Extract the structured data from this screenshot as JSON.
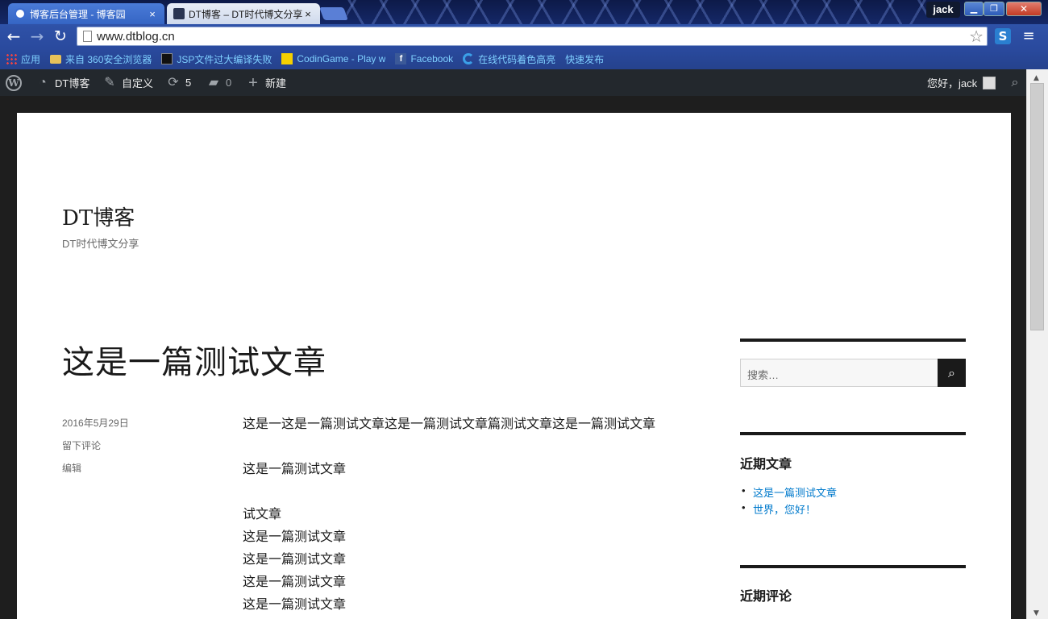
{
  "browser": {
    "tabs": [
      {
        "title": "博客后台管理 - 博客园",
        "close": "×"
      },
      {
        "title": "DT博客 – DT时代博文分享",
        "close": "×"
      }
    ],
    "user": "jack",
    "window_buttons": {
      "min": "▁",
      "max": "❐",
      "close": "✕"
    },
    "url": "www.dtblog.cn",
    "nav": {
      "back": "←",
      "forward": "→",
      "reload": "↻",
      "star": "☆",
      "menu": "≡",
      "extension": "S"
    },
    "bookmarks": [
      {
        "label": "应用",
        "icon": "apps-icon"
      },
      {
        "label": "来自 360安全浏览器",
        "icon": "folder-icon"
      },
      {
        "label": "JSP文件过大编译失败",
        "icon": "jsp-icon"
      },
      {
        "label": "CodinGame - Play w",
        "icon": "codingame-icon"
      },
      {
        "label": "Facebook",
        "icon": "facebook-icon"
      },
      {
        "label": "在线代码着色高亮",
        "icon": "c-icon"
      },
      {
        "label": "快速发布",
        "icon": "page-icon"
      }
    ]
  },
  "adminbar": {
    "site_name": "DT博客",
    "customize": "自定义",
    "updates_count": "5",
    "comments_count": "0",
    "new_label": "新建",
    "greeting": "您好，jack"
  },
  "site": {
    "title": "DT博客",
    "description": "DT时代博文分享"
  },
  "post": {
    "title": "这是一篇测试文章",
    "date": "2016年5月29日",
    "comment_link": "留下评论",
    "edit_link": "编辑",
    "paragraphs": [
      "这是一这是一篇测试文章这是一篇测试文章篇测试文章这是一篇测试文章",
      "这是一篇测试文章"
    ],
    "lines": [
      "试文章",
      "这是一篇测试文章",
      "这是一篇测试文章",
      "这是一篇测试文章",
      "这是一篇测试文章"
    ]
  },
  "sidebar": {
    "search_placeholder": "搜索…",
    "recent_posts_title": "近期文章",
    "recent_posts": [
      "这是一篇测试文章",
      "世界，您好！"
    ],
    "recent_comments_title": "近期评论"
  },
  "colors": {
    "link": "#007acc",
    "adminbar": "#23282d",
    "text": "#1a1a1a"
  }
}
